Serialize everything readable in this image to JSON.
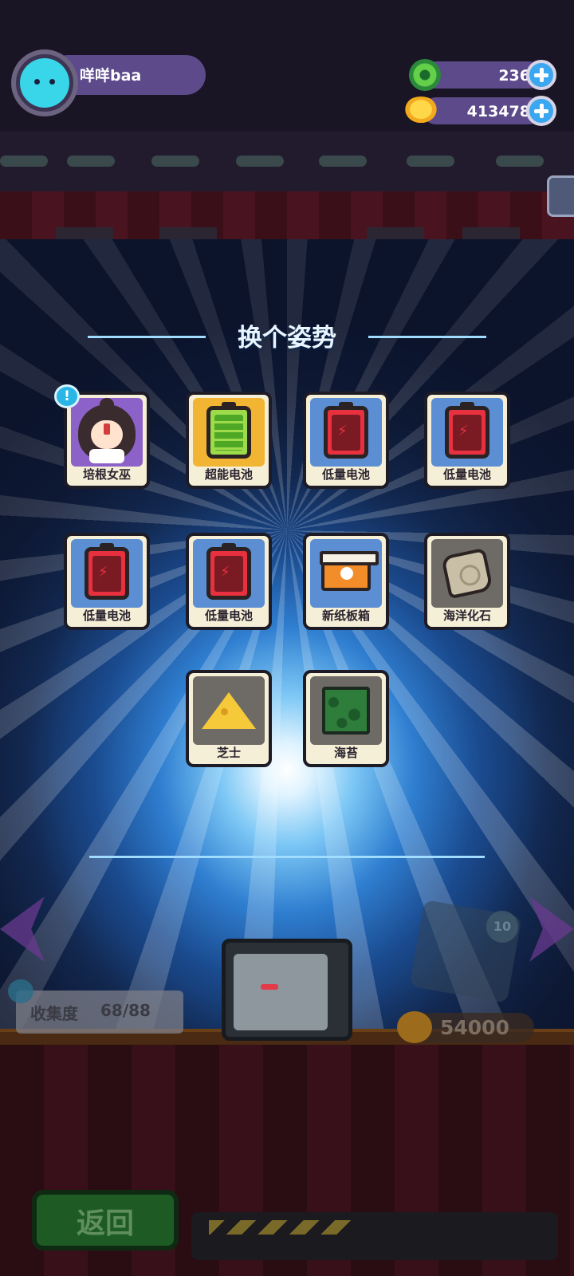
{
  "player": {
    "name": "咩咩baa"
  },
  "currencies": [
    {
      "icon": "green-donut-coin-icon",
      "value": "236"
    },
    {
      "icon": "gold-planet-coin-icon",
      "value": "413478"
    }
  ],
  "popup": {
    "title": "换个姿势",
    "items": [
      {
        "label": "培根女巫",
        "icon": "witch-character-icon",
        "bg": "#8c62c8"
      },
      {
        "label": "超能电池",
        "icon": "green-battery-icon",
        "bg": "#f2b433"
      },
      {
        "label": "低量电池",
        "icon": "red-battery-icon",
        "bg": "#5c8ed4"
      },
      {
        "label": "低量电池",
        "icon": "red-battery-icon",
        "bg": "#5c8ed4"
      },
      {
        "label": "低量电池",
        "icon": "red-battery-icon",
        "bg": "#5c8ed4"
      },
      {
        "label": "低量电池",
        "icon": "red-battery-icon",
        "bg": "#5c8ed4"
      },
      {
        "label": "新纸板箱",
        "icon": "cardboard-box-icon",
        "bg": "#5c8ed4"
      },
      {
        "label": "海洋化石",
        "icon": "fossil-icon",
        "bg": "#6e6a65"
      },
      {
        "label": "芝士",
        "icon": "cheese-icon",
        "bg": "#6e6a65"
      },
      {
        "label": "海苔",
        "icon": "seaweed-icon",
        "bg": "#6e6a65"
      }
    ],
    "new_badge": "!"
  },
  "background": {
    "collection_label": "收集度",
    "collection_value": "68/88",
    "price": "54000",
    "machine_count": "10",
    "back_label": "返回"
  },
  "colors": {
    "accent_line": "#9fdcff",
    "pill": "#5c4a8a",
    "plus": "#3aa7f0"
  }
}
